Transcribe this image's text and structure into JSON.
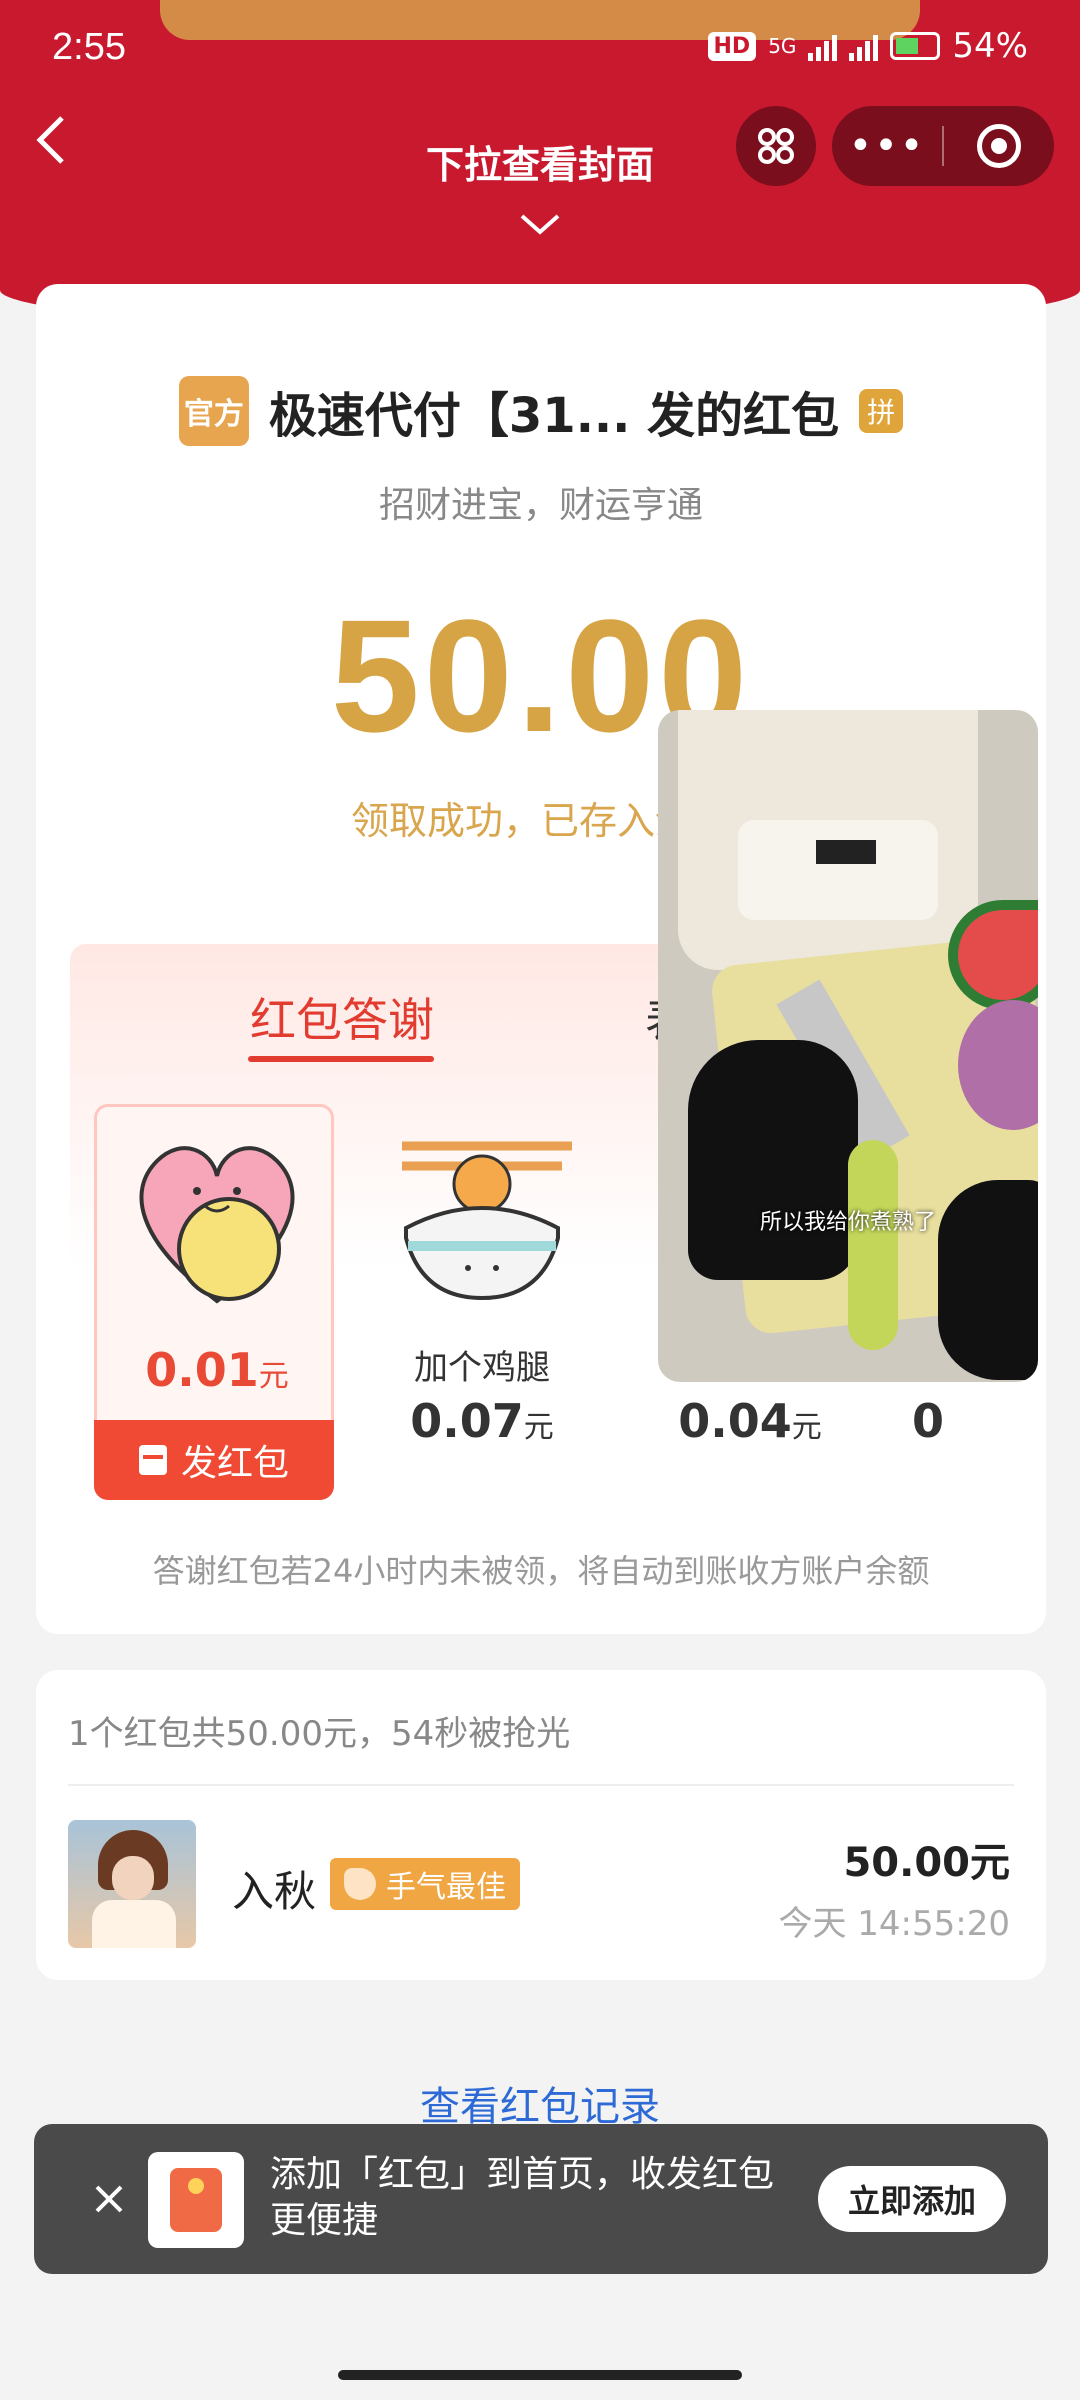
{
  "status_bar": {
    "time": "2:55",
    "hd": "HD",
    "network": "5G",
    "battery": "54%"
  },
  "nav": {
    "title": "下拉查看封面"
  },
  "sender": {
    "official_badge": "官方",
    "name": "极速代付【31... 发的红包",
    "pin_badge": "拼"
  },
  "blessing": "招财进宝，财运亨通",
  "amount": "50.00",
  "status_message": "领取成功，已存入余额",
  "thanks": {
    "tabs": [
      "红包答谢",
      "表"
    ],
    "gifts": [
      {
        "name": "",
        "price": "0.01",
        "unit": "元"
      },
      {
        "name": "加个鸡腿",
        "price": "0.07",
        "unit": "元"
      },
      {
        "name": "",
        "price": "0.04",
        "unit": "元"
      },
      {
        "name": "",
        "price": "0",
        "unit": ""
      }
    ],
    "send_button": "发红包",
    "note": "答谢红包若24小时内未被领，将自动到账收方账户余额"
  },
  "video": {
    "subtitle": "所以我给你煮熟了"
  },
  "summary": "1个红包共50.00元，54秒被抢光",
  "receiver": {
    "name": "入秋",
    "badge": "手气最佳",
    "amount": "50.00元",
    "time": "今天 14:55:20"
  },
  "records_link": "查看红包记录",
  "toast": {
    "text": "添加「红包」到首页，收发红包更便捷",
    "button": "立即添加"
  },
  "colors": {
    "header": "#c8192f",
    "amount": "#d6a445",
    "accent": "#f04a35",
    "link": "#2d6ad6"
  }
}
